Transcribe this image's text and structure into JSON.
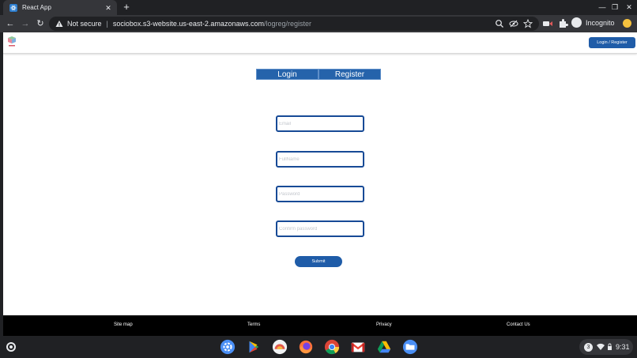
{
  "browser": {
    "tab_title": "React App",
    "tab_close": "✕",
    "new_tab": "+",
    "window_controls": [
      "—",
      "❐",
      "✕"
    ],
    "security_label": "Not secure",
    "url_host": "sociobox.s3-website.us-east-2.amazonaws.com",
    "url_path": "/logreg/register",
    "incognito_label": "Incognito"
  },
  "header": {
    "login_register_button": "Login / Register"
  },
  "auth_tabs": {
    "login": "Login",
    "register": "Register"
  },
  "form": {
    "email_placeholder": "Email",
    "fullname_placeholder": "FullName",
    "password_placeholder": "Password",
    "confirm_password_placeholder": "Confirm password",
    "submit_label": "Submit"
  },
  "footer": {
    "links": [
      "Site map",
      "Terms",
      "Privacy",
      "Contact Us"
    ]
  },
  "shelf": {
    "notification_count": "3",
    "time": "9:31",
    "apps": [
      "settings-icon",
      "play-store-icon",
      "app-icon",
      "firefox-icon",
      "chrome-icon",
      "gmail-icon",
      "drive-icon",
      "files-icon"
    ]
  },
  "colors": {
    "brand_blue": "#1f5ca8",
    "field_border": "#174a96"
  }
}
